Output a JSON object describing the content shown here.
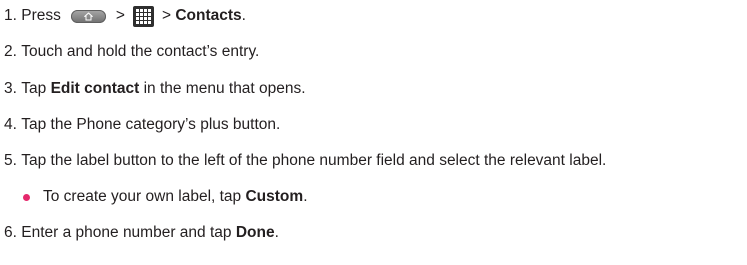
{
  "steps": [
    {
      "num": "1.",
      "press": "Press",
      "sep1": ">",
      "sep2": ">",
      "target": "Contacts",
      "end": "."
    },
    {
      "num": "2.",
      "text": "Touch and hold the contact’s entry."
    },
    {
      "num": "3.",
      "pre": "Tap",
      "bold": "Edit contact",
      "post": "in the menu that opens."
    },
    {
      "num": "4.",
      "text": "Tap the Phone category’s plus button."
    },
    {
      "num": "5.",
      "text": "Tap the label button to the left of the phone number field and select the relevant label."
    },
    {
      "num": "6.",
      "pre": "Enter a phone number and tap",
      "bold": "Done",
      "end": "."
    }
  ],
  "sub_bullet": {
    "pre": "To create your own label, tap",
    "bold": "Custom",
    "end": "."
  },
  "icons": {
    "home_key": "home-key-icon",
    "apps_grid": "apps-grid-icon",
    "bullet_color": "#e5286c"
  }
}
